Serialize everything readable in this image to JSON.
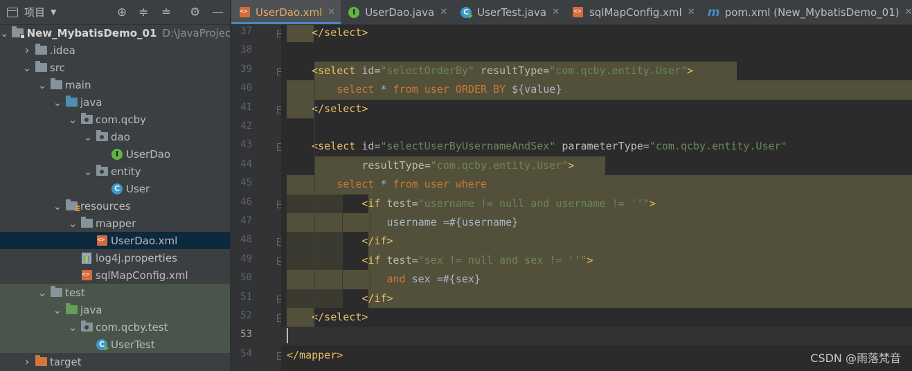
{
  "project_panel": {
    "title": "项目",
    "tree": [
      {
        "name": "New_MybatisDemo_01",
        "path": "D:\\JavaProjec",
        "icon": "module-folder-icon",
        "expanded": true
      },
      {
        "name": ".idea",
        "icon": "folder-icon",
        "expanded": false
      },
      {
        "name": "src",
        "icon": "folder-icon",
        "expanded": true
      },
      {
        "name": "main",
        "icon": "folder-icon",
        "expanded": true
      },
      {
        "name": "java",
        "icon": "source-folder-icon",
        "expanded": true
      },
      {
        "name": "com.qcby",
        "icon": "package-icon",
        "expanded": true
      },
      {
        "name": "dao",
        "icon": "package-icon",
        "expanded": true
      },
      {
        "name": "UserDao",
        "icon": "interface-icon"
      },
      {
        "name": "entity",
        "icon": "package-icon",
        "expanded": true
      },
      {
        "name": "User",
        "icon": "class-icon"
      },
      {
        "name": "resources",
        "icon": "resources-folder-icon",
        "expanded": true
      },
      {
        "name": "mapper",
        "icon": "folder-icon",
        "expanded": true
      },
      {
        "name": "UserDao.xml",
        "icon": "xml-file-icon",
        "selected": true
      },
      {
        "name": "log4j.properties",
        "icon": "properties-file-icon"
      },
      {
        "name": "sqlMapConfig.xml",
        "icon": "xml-file-icon"
      },
      {
        "name": "test",
        "icon": "folder-icon",
        "expanded": true
      },
      {
        "name": "java",
        "icon": "test-folder-icon",
        "expanded": true
      },
      {
        "name": "com.qcby.test",
        "icon": "package-icon",
        "expanded": true
      },
      {
        "name": "UserTest",
        "icon": "test-class-icon"
      },
      {
        "name": "target",
        "icon": "excluded-folder-icon",
        "expanded": false
      }
    ]
  },
  "tabs": [
    {
      "label": "UserDao.xml",
      "icon": "xml-file-icon",
      "active": true
    },
    {
      "label": "UserDao.java",
      "icon": "interface-icon",
      "active": false
    },
    {
      "label": "UserTest.java",
      "icon": "test-class-icon",
      "active": false
    },
    {
      "label": "sqlMapConfig.xml",
      "icon": "xml-file-icon",
      "active": false
    },
    {
      "label": "pom.xml (New_MybatisDemo_01)",
      "icon": "maven-icon",
      "active": false
    }
  ],
  "editor": {
    "current_line": "53",
    "lines": [
      {
        "n": "37",
        "tokens": [
          {
            "t": "    ",
            "c": "pl"
          },
          {
            "t": "</select>",
            "c": "tg"
          }
        ]
      },
      {
        "n": "38",
        "tokens": []
      },
      {
        "n": "39",
        "tokens": [
          {
            "t": "    ",
            "c": "pl"
          },
          {
            "t": "<select ",
            "c": "tg"
          },
          {
            "t": "id",
            "c": "an"
          },
          {
            "t": "=",
            "c": "an"
          },
          {
            "t": "\"selectOrderBy\"",
            "c": "av"
          },
          {
            "t": " resultType",
            "c": "an"
          },
          {
            "t": "=",
            "c": "an"
          },
          {
            "t": "\"com.qcby.entity.User\"",
            "c": "av"
          },
          {
            "t": ">",
            "c": "tg"
          }
        ]
      },
      {
        "n": "40",
        "tokens": [
          {
            "t": "        ",
            "c": "pl"
          },
          {
            "t": "select",
            "c": "kw"
          },
          {
            "t": " * ",
            "c": "pl"
          },
          {
            "t": "from",
            "c": "kw"
          },
          {
            "t": " user ",
            "c": "kw"
          },
          {
            "t": "ORDER BY",
            "c": "kw"
          },
          {
            "t": " ${value}",
            "c": "vw"
          }
        ]
      },
      {
        "n": "41",
        "tokens": [
          {
            "t": "    ",
            "c": "pl"
          },
          {
            "t": "</select>",
            "c": "tg"
          }
        ]
      },
      {
        "n": "42",
        "tokens": []
      },
      {
        "n": "43",
        "tokens": [
          {
            "t": "    ",
            "c": "pl"
          },
          {
            "t": "<select ",
            "c": "tg"
          },
          {
            "t": "id",
            "c": "an"
          },
          {
            "t": "=",
            "c": "an"
          },
          {
            "t": "\"selectUserByUsernameAndSex\"",
            "c": "av"
          },
          {
            "t": " parameterType",
            "c": "an"
          },
          {
            "t": "=",
            "c": "an"
          },
          {
            "t": "\"com.qcby.entity.User\"",
            "c": "av"
          }
        ]
      },
      {
        "n": "44",
        "tokens": [
          {
            "t": "            ",
            "c": "pl"
          },
          {
            "t": "resultType",
            "c": "an"
          },
          {
            "t": "=",
            "c": "an"
          },
          {
            "t": "\"com.qcby.entity.User\"",
            "c": "av"
          },
          {
            "t": ">",
            "c": "tg"
          }
        ]
      },
      {
        "n": "45",
        "tokens": [
          {
            "t": "        ",
            "c": "pl"
          },
          {
            "t": "select",
            "c": "kw"
          },
          {
            "t": " * ",
            "c": "pl"
          },
          {
            "t": "from",
            "c": "kw"
          },
          {
            "t": " user ",
            "c": "kw"
          },
          {
            "t": "where",
            "c": "kw"
          }
        ]
      },
      {
        "n": "46",
        "tokens": [
          {
            "t": "            ",
            "c": "pl"
          },
          {
            "t": "<if ",
            "c": "tg"
          },
          {
            "t": "test",
            "c": "an"
          },
          {
            "t": "=",
            "c": "an"
          },
          {
            "t": "\"username != null and username != ''\"",
            "c": "av"
          },
          {
            "t": ">",
            "c": "tg"
          }
        ]
      },
      {
        "n": "47",
        "tokens": [
          {
            "t": "                username =#{username}",
            "c": "pl"
          }
        ]
      },
      {
        "n": "48",
        "tokens": [
          {
            "t": "            ",
            "c": "pl"
          },
          {
            "t": "</if>",
            "c": "tg"
          }
        ]
      },
      {
        "n": "49",
        "tokens": [
          {
            "t": "            ",
            "c": "pl"
          },
          {
            "t": "<if ",
            "c": "tg"
          },
          {
            "t": "test",
            "c": "an"
          },
          {
            "t": "=",
            "c": "an"
          },
          {
            "t": "\"sex != null and sex != ''\"",
            "c": "av"
          },
          {
            "t": ">",
            "c": "tg"
          }
        ]
      },
      {
        "n": "50",
        "tokens": [
          {
            "t": "                ",
            "c": "pl"
          },
          {
            "t": "and",
            "c": "kw"
          },
          {
            "t": " sex =#{sex}",
            "c": "pl"
          }
        ]
      },
      {
        "n": "51",
        "tokens": [
          {
            "t": "            ",
            "c": "pl"
          },
          {
            "t": "</if>",
            "c": "tg"
          }
        ]
      },
      {
        "n": "52",
        "tokens": [
          {
            "t": "    ",
            "c": "pl"
          },
          {
            "t": "</select>",
            "c": "tg"
          }
        ]
      },
      {
        "n": "53",
        "tokens": []
      },
      {
        "n": "54",
        "tokens": [
          {
            "t": "</mapper>",
            "c": "tg"
          }
        ]
      }
    ]
  },
  "watermark": "CSDN @雨落梵音",
  "colors": {
    "tag": "#e8bf6a",
    "attr_name": "#bababa",
    "attr_value": "#6a8759",
    "keyword": "#cc7832",
    "plain": "#a9b7c6",
    "injected_highlight": "#52503a",
    "selection": "#0d293e"
  }
}
